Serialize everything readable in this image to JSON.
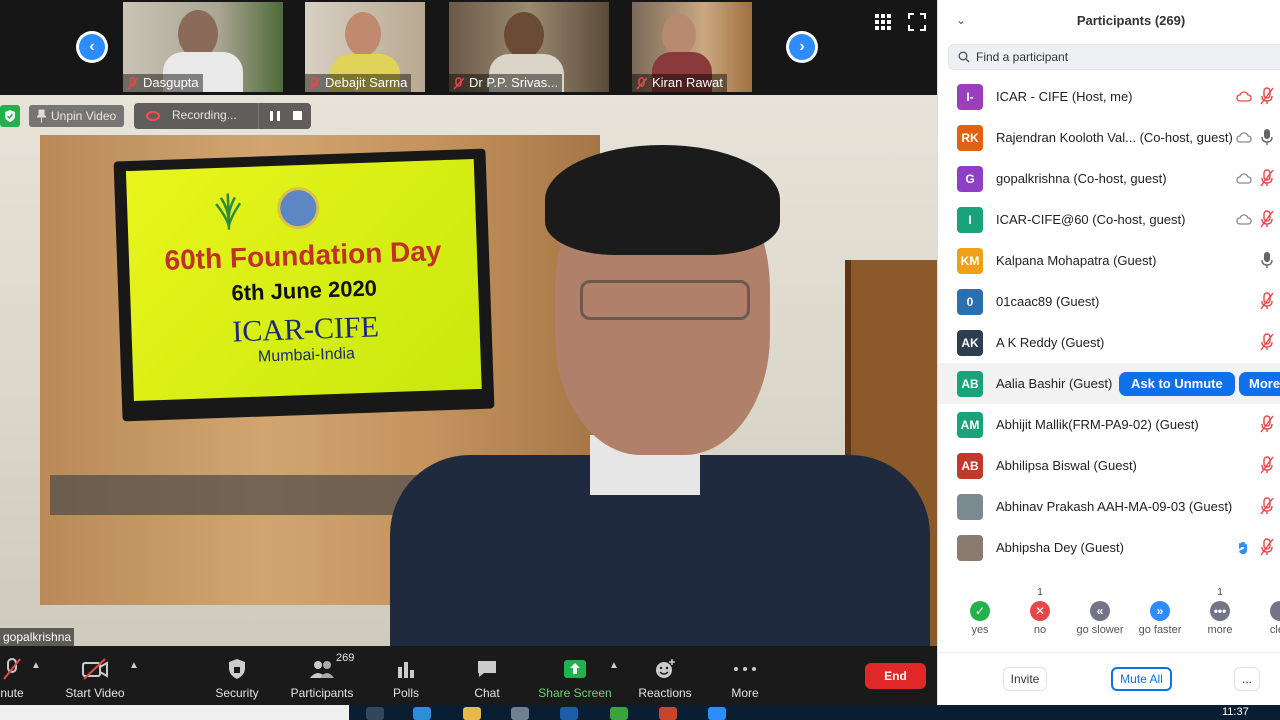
{
  "gallery": {
    "thumbnails": [
      {
        "name": "Dasgupta"
      },
      {
        "name": "Debajit Sarma"
      },
      {
        "name": "Dr P.P. Srivas..."
      },
      {
        "name": "Kiran Rawat"
      }
    ]
  },
  "video": {
    "unpin_label": "Unpin Video",
    "recording_label": "Recording...",
    "speaker_name": "gopalkrishna",
    "screen_text": {
      "line1": "60th Foundation Day",
      "line2": "6th June 2020",
      "line3": "ICAR-CIFE",
      "line4": "Mumbai-India"
    }
  },
  "toolbar": {
    "mute_label": "nute",
    "start_video_label": "Start Video",
    "security_label": "Security",
    "participants_label": "Participants",
    "participants_count": "269",
    "polls_label": "Polls",
    "chat_label": "Chat",
    "share_label": "Share Screen",
    "reactions_label": "Reactions",
    "more_label": "More",
    "end_label": "End"
  },
  "panel": {
    "title": "Participants (269)",
    "search_placeholder": "Find a participant",
    "participants": [
      {
        "initials": "I-",
        "color": "#9b3fbf",
        "name": "ICAR - CIFE (Host, me)",
        "video": "off",
        "mic": "muted"
      },
      {
        "initials": "RK",
        "color": "#e0620f",
        "name": "Rajendran Kooloth Val... (Co-host, guest)",
        "video": "off",
        "mic": "on"
      },
      {
        "initials": "G",
        "color": "#8e3fc6",
        "name": "gopalkrishna (Co-host, guest)",
        "video": "off",
        "mic": "muted"
      },
      {
        "initials": "I",
        "color": "#18a37a",
        "name": "ICAR-CIFE@60 (Co-host, guest)",
        "video": "off",
        "mic": "muted"
      },
      {
        "initials": "KM",
        "color": "#f0a018",
        "name": "Kalpana Mohapatra (Guest)",
        "video": "none",
        "mic": "on"
      },
      {
        "initials": "0",
        "color": "#2a6fb0",
        "name": "01caac89 (Guest)",
        "video": "none",
        "mic": "muted"
      },
      {
        "initials": "AK",
        "color": "#2c3e50",
        "name": "A K Reddy (Guest)",
        "video": "none",
        "mic": "muted"
      },
      {
        "initials": "AB",
        "color": "#18a37a",
        "name": "Aalia Bashir (Guest)",
        "video": "none",
        "mic": "none",
        "ask_label": "Ask to Unmute",
        "more_label": "More"
      },
      {
        "initials": "AM",
        "color": "#18a37a",
        "name": "Abhijit Mallik(FRM-PA9-02) (Guest)",
        "video": "none",
        "mic": "muted"
      },
      {
        "initials": "AB",
        "color": "#c0392b",
        "name": "Abhilipsa Biswal (Guest)",
        "video": "none",
        "mic": "muted"
      },
      {
        "initials": "",
        "color": "#7a8a90",
        "name": "Abhinav Prakash AAH-MA-09-03 (Guest)",
        "video": "none",
        "mic": "muted"
      },
      {
        "initials": "",
        "color": "#8a7a70",
        "name": "Abhipsha Dey (Guest)",
        "video": "hand",
        "mic": "muted"
      }
    ],
    "feedback": [
      {
        "label": "yes",
        "count": "",
        "color": "#23b14d",
        "glyph": "✓"
      },
      {
        "label": "no",
        "count": "1",
        "color": "#e54848",
        "glyph": "✕"
      },
      {
        "label": "go slower",
        "count": "",
        "color": "#747487",
        "glyph": "«"
      },
      {
        "label": "go faster",
        "count": "",
        "color": "#2D8CFF",
        "glyph": "»"
      },
      {
        "label": "more",
        "count": "1",
        "color": "#747487",
        "glyph": "•••"
      },
      {
        "label": "clea",
        "count": "",
        "color": "#747487",
        "glyph": ""
      }
    ],
    "invite_label": "Invite",
    "mute_all_label": "Mute All",
    "dots_label": "..."
  },
  "taskbar": {
    "time": "11:37"
  }
}
